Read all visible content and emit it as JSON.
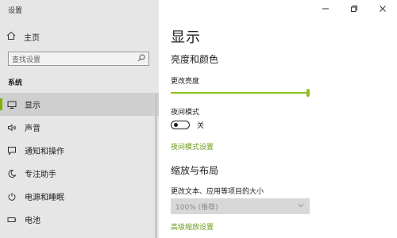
{
  "window": {
    "app_title": "设置"
  },
  "colors": {
    "accent": "#8cc21b",
    "link": "#6c9a1e",
    "sidebar_bg": "#e6e6e6"
  },
  "sidebar": {
    "home_label": "主页",
    "search_placeholder": "查找设置",
    "section_label": "系统",
    "items": [
      {
        "label": "显示",
        "icon": "monitor-icon",
        "active": true
      },
      {
        "label": "声音",
        "icon": "speaker-icon",
        "active": false
      },
      {
        "label": "通知和操作",
        "icon": "notification-icon",
        "active": false
      },
      {
        "label": "专注助手",
        "icon": "moon-icon",
        "active": false
      },
      {
        "label": "电源和睡眠",
        "icon": "power-icon",
        "active": false
      },
      {
        "label": "电池",
        "icon": "battery-icon",
        "active": false
      }
    ]
  },
  "main": {
    "title": "显示",
    "brightness_heading": "亮度和颜色",
    "brightness_label": "更改亮度",
    "brightness_value": 1.0,
    "night_light_label": "夜间模式",
    "night_light_state": "关",
    "night_light_settings_link": "夜间模式设置",
    "scale_heading": "缩放与布局",
    "scale_label": "更改文本、应用等项目的大小",
    "scale_value": "100% (推荐)",
    "advanced_scale_link": "高级缩放设置"
  }
}
